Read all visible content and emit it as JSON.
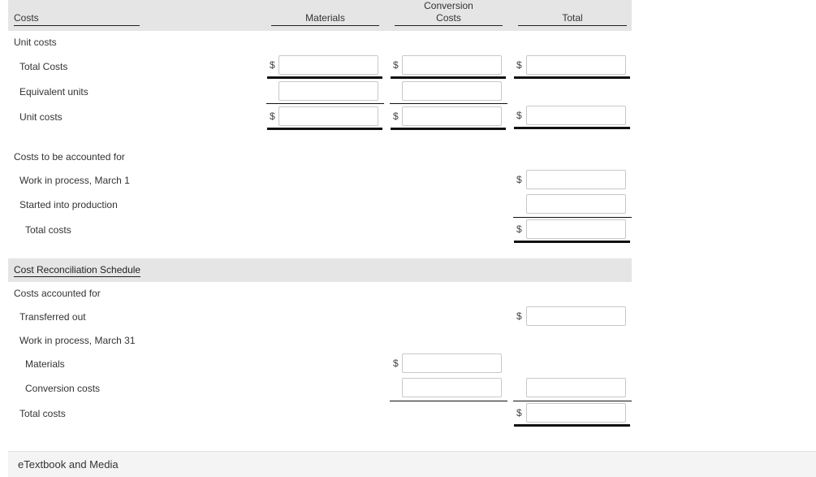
{
  "header": {
    "costs_label": "Costs",
    "materials_label": "Materials",
    "conversion_label_line1": "Conversion",
    "conversion_label_line2": "Costs",
    "total_label": "Total"
  },
  "unit_costs_section": {
    "title": "Unit costs",
    "rows": [
      {
        "label": "Total Costs",
        "materials": "",
        "conversion": "",
        "total": ""
      },
      {
        "label": "Equivalent units",
        "materials": "",
        "conversion": ""
      },
      {
        "label": "Unit costs",
        "materials": "",
        "conversion": "",
        "total": ""
      }
    ]
  },
  "costs_to_account_section": {
    "title": "Costs to be accounted for",
    "rows": [
      {
        "label": "Work in process, March 1",
        "total": ""
      },
      {
        "label": "Started into production",
        "total": ""
      },
      {
        "label": "Total costs",
        "total": ""
      }
    ]
  },
  "reconciliation": {
    "title": "Cost Reconciliation Schedule",
    "section_title": "Costs accounted for",
    "rows": [
      {
        "label": "Transferred out",
        "total": ""
      },
      {
        "label": "Work in process, March 31"
      },
      {
        "label": "Materials",
        "conversion": ""
      },
      {
        "label": "Conversion costs",
        "conversion": "",
        "total": ""
      },
      {
        "label": "Total costs",
        "total": ""
      }
    ]
  },
  "currency_symbol": "$",
  "footer": {
    "label": "eTextbook and Media"
  }
}
